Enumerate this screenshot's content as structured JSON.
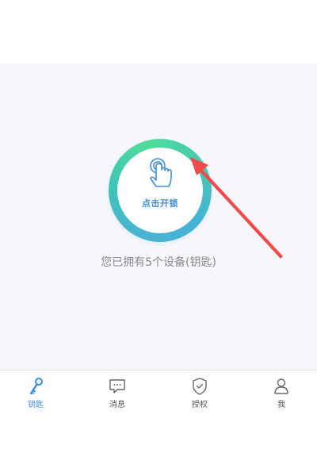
{
  "unlock": {
    "label": "点击开锁",
    "icon": "finger-touch-icon"
  },
  "status": {
    "device_count_text": "您已拥有5个设备(钥匙)"
  },
  "tabs": [
    {
      "label": "钥匙",
      "icon": "key-icon",
      "active": true
    },
    {
      "label": "消息",
      "icon": "message-icon",
      "active": false
    },
    {
      "label": "授权",
      "icon": "shield-check-icon",
      "active": false
    },
    {
      "label": "我",
      "icon": "person-icon",
      "active": false
    }
  ],
  "colors": {
    "accent": "#3b8de0",
    "ring_teal": "#49b3d2",
    "ring_green": "#4fdc9a",
    "annotation_arrow": "#f04a4a",
    "background": "#f6f7fc"
  }
}
